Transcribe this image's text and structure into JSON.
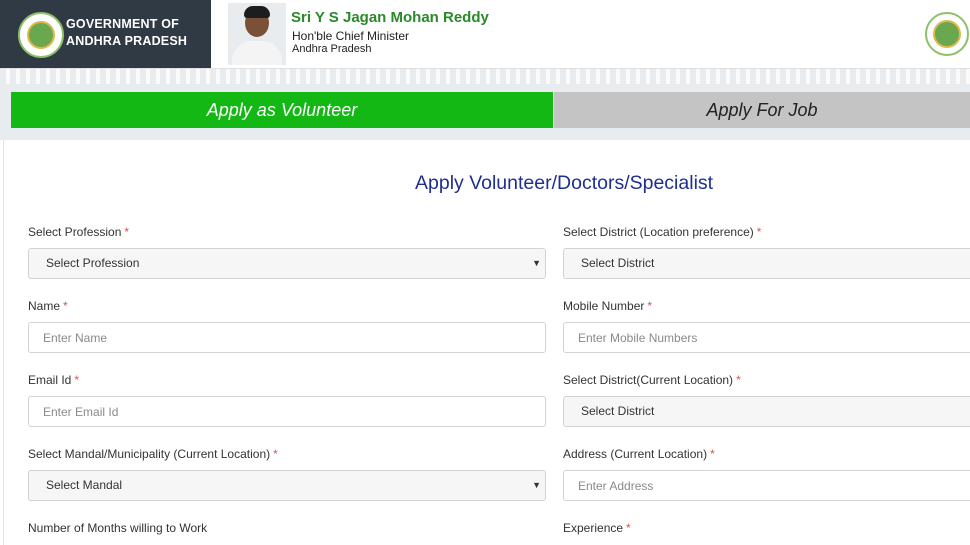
{
  "header": {
    "gov_line1": "GOVERNMENT OF",
    "gov_line2": "ANDHRA PRADESH",
    "cm_name": "Sri Y S Jagan Mohan Reddy",
    "cm_title": "Hon'ble Chief Minister",
    "cm_state": "Andhra Pradesh"
  },
  "tabs": {
    "volunteer": "Apply as Volunteer",
    "job": "Apply For Job"
  },
  "form": {
    "title": "Apply Volunteer/Doctors/Specialist",
    "profession": {
      "label": "Select Profession",
      "value": "Select Profession"
    },
    "district_pref": {
      "label": "Select District (Location preference)",
      "value": "Select District"
    },
    "name": {
      "label": "Name",
      "placeholder": "Enter Name"
    },
    "mobile": {
      "label": "Mobile Number",
      "placeholder": "Enter Mobile Numbers"
    },
    "email": {
      "label": "Email Id",
      "placeholder": "Enter Email Id"
    },
    "district_current": {
      "label": "Select District(Current Location)",
      "value": "Select District"
    },
    "mandal": {
      "label": "Select Mandal/Municipality (Current Location)",
      "value": "Select Mandal"
    },
    "address": {
      "label": "Address (Current Location)",
      "placeholder": "Enter Address"
    },
    "months": {
      "label": "Number of Months willing to Work"
    },
    "experience": {
      "label": "Experience"
    },
    "required_mark": "*"
  },
  "colors": {
    "active_tab": "#14b814",
    "inactive_tab": "#c4c4c4",
    "title": "#1f2f8f",
    "required": "#d9534f",
    "cm_name": "#2a8a2a"
  }
}
